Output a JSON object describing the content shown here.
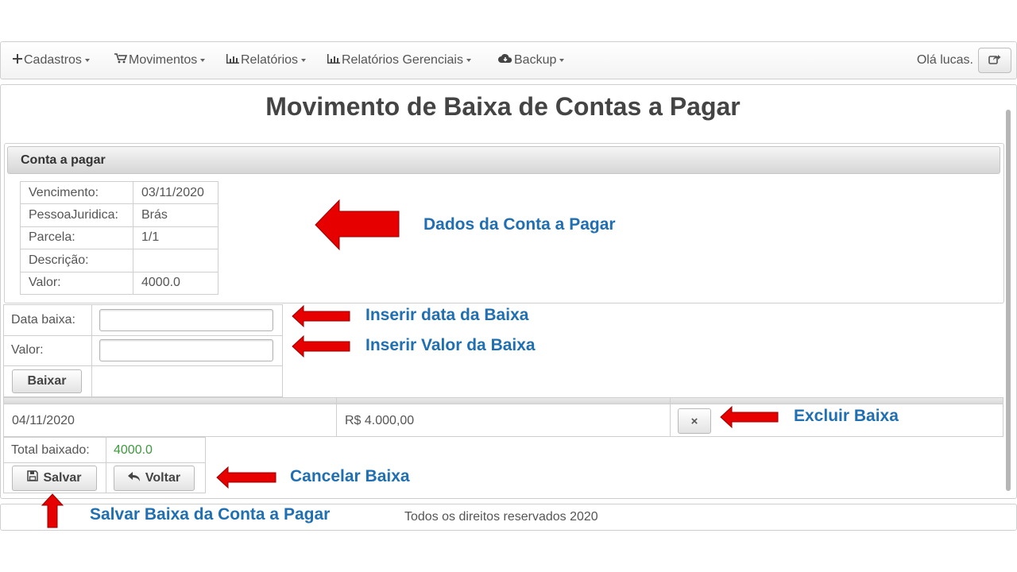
{
  "nav": {
    "items": [
      {
        "icon": "plus-icon",
        "label": "Cadastros"
      },
      {
        "icon": "cart-icon",
        "label": "Movimentos"
      },
      {
        "icon": "bar-chart-icon",
        "label": "Relatórios"
      },
      {
        "icon": "bar-chart-icon",
        "label": "Relatórios Gerenciais"
      },
      {
        "icon": "cloud-download-icon",
        "label": "Backup"
      }
    ],
    "greeting": "Olá lucas.",
    "logout_icon": "share-icon"
  },
  "page": {
    "title": "Movimento de Baixa de Contas a Pagar"
  },
  "conta": {
    "header": "Conta a pagar",
    "rows": [
      {
        "label": "Vencimento:",
        "value": "03/11/2020"
      },
      {
        "label": "PessoaJuridica:",
        "value": "Brás"
      },
      {
        "label": "Parcela:",
        "value": "1/1"
      },
      {
        "label": "Descrição:",
        "value": ""
      },
      {
        "label": "Valor:",
        "value": "4000.0"
      }
    ]
  },
  "form": {
    "date_label": "Data baixa:",
    "date_value": "",
    "value_label": "Valor:",
    "value_value": "",
    "baixar_label": "Baixar"
  },
  "baixas": [
    {
      "date": "04/11/2020",
      "amount": "R$ 4.000,00",
      "delete_label": "×"
    }
  ],
  "totals": {
    "label": "Total baixado:",
    "value": "4000.0",
    "value_color": "#3c9a3c"
  },
  "actions": {
    "save_label": "Salvar",
    "back_label": "Voltar"
  },
  "footer": {
    "text": "Todos os direitos reservados 2020"
  },
  "annotations": {
    "dados": "Dados da Conta a Pagar",
    "inserir_data": "Inserir data da Baixa",
    "inserir_valor": "Inserir Valor da Baixa",
    "excluir": "Excluir Baixa",
    "cancelar": "Cancelar Baixa",
    "salvar": "Salvar Baixa da Conta a Pagar",
    "text_color": "#1f6fb2",
    "arrow_color": "#e60000"
  }
}
